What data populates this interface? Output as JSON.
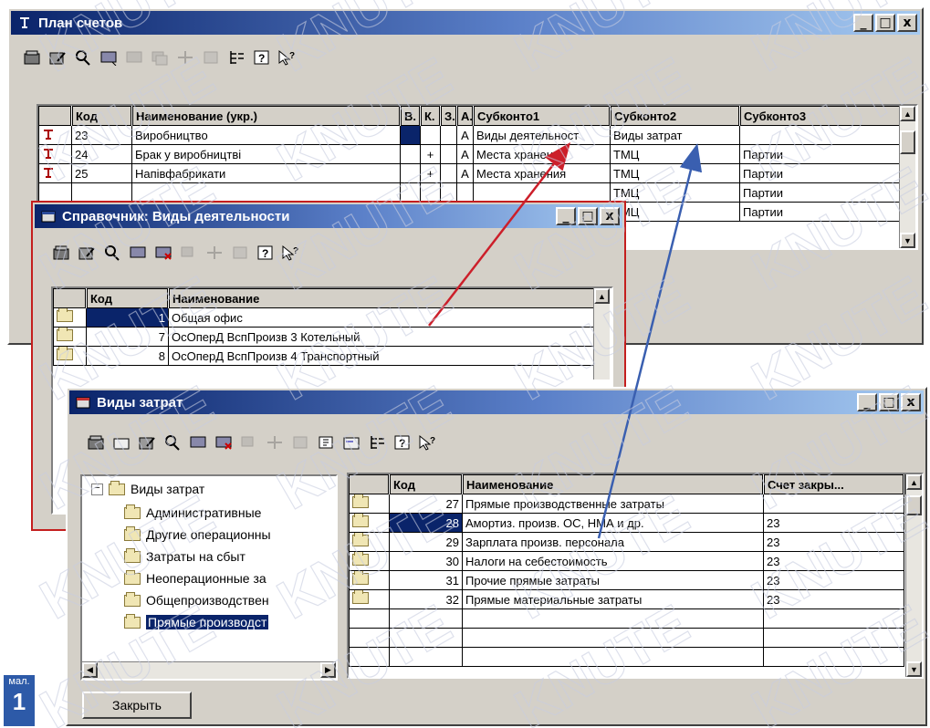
{
  "plan": {
    "title": "План счетов",
    "columns": [
      "Код",
      "Наименование (укр.)",
      "В.",
      "К.",
      "З.",
      "А.",
      "Субконто1",
      "Субконто2",
      "Субконто3"
    ],
    "rows": [
      {
        "code": "23",
        "name": "Виробництво",
        "v": "",
        "k": "",
        "z": "",
        "a": "А",
        "s1": "Виды деятельност",
        "s2": "Виды затрат",
        "s3": ""
      },
      {
        "code": "24",
        "name": "Брак у виробництві",
        "v": "",
        "k": "+",
        "z": "",
        "a": "А",
        "s1": "Места хранения",
        "s2": "ТМЦ",
        "s3": "Партии"
      },
      {
        "code": "25",
        "name": "Напівфабрикати",
        "v": "",
        "k": "+",
        "z": "",
        "a": "А",
        "s1": "Места хранения",
        "s2": "ТМЦ",
        "s3": "Партии"
      },
      {
        "code": "",
        "name": "",
        "v": "",
        "k": "",
        "z": "",
        "a": "",
        "s1": "",
        "s2": "ТМЦ",
        "s3": "Партии"
      },
      {
        "code": "",
        "name": "",
        "v": "",
        "k": "",
        "z": "",
        "a": "",
        "s1": "",
        "s2": "ТМЦ",
        "s3": "Партии"
      }
    ]
  },
  "sprav": {
    "title": "Справочник: Виды деятельности",
    "columns": [
      "Код",
      "Наименование"
    ],
    "rows": [
      {
        "code": "1",
        "name": "Общая офис"
      },
      {
        "code": "7",
        "name": "ОсОперД ВспПроизв 3 Котельный"
      },
      {
        "code": "8",
        "name": "ОсОперД ВспПроизв 4 Транспортный"
      }
    ]
  },
  "zatr": {
    "title": "Виды затрат",
    "tree": {
      "root": "Виды затрат",
      "items": [
        "Административные",
        "Другие операционны",
        "Затраты на сбыт",
        "Неоперационные за",
        "Общепроизводствен",
        "Прямые производст"
      ]
    },
    "columns": [
      "Код",
      "Наименование",
      "Счет закры..."
    ],
    "rows": [
      {
        "code": "27",
        "name": "Прямые производственные затраты",
        "acc": ""
      },
      {
        "code": "28",
        "name": "Амортиз. произв. ОС, НМА и др.",
        "acc": "23"
      },
      {
        "code": "29",
        "name": "Зарплата произв. персонала",
        "acc": "23"
      },
      {
        "code": "30",
        "name": "Налоги на себестоимость",
        "acc": "23"
      },
      {
        "code": "31",
        "name": "Прочие прямые затраты",
        "acc": "23"
      },
      {
        "code": "32",
        "name": "Прямые материальные затраты",
        "acc": "23"
      }
    ],
    "close_button": "Закрыть"
  },
  "window_buttons": {
    "minimize": "_",
    "maximize": "□",
    "close": "x"
  },
  "badge": {
    "line1": "мал.",
    "line2": "1"
  },
  "colors": {
    "title_start": "#0a246a",
    "title_end": "#a6caf0",
    "face": "#d4d0c8",
    "selection": "#0a246a",
    "arrow_red": "#cc1f2a",
    "arrow_blue": "#3a5fb0"
  }
}
